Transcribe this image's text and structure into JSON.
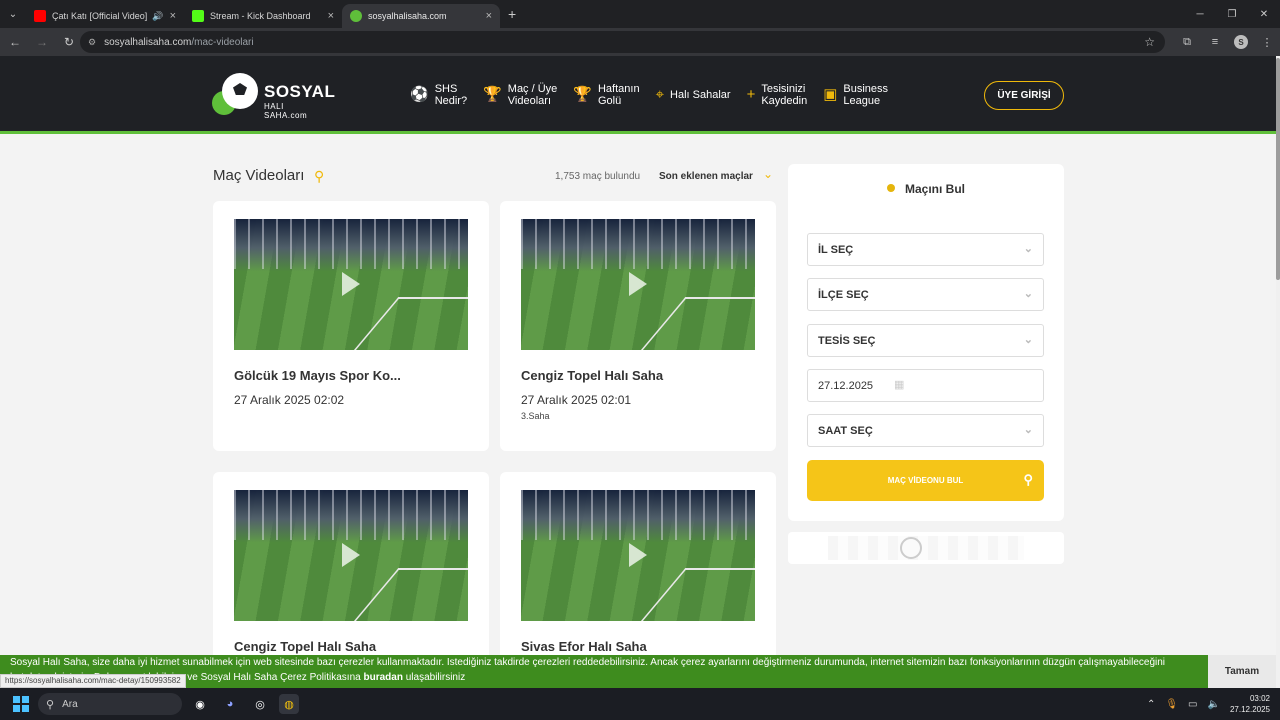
{
  "browser": {
    "tabs": [
      {
        "title": "Çatı Katı [Official Video] - G",
        "favicon_color": "#ff0000",
        "active": false,
        "audio": true
      },
      {
        "title": "Stream - Kick Dashboard",
        "favicon_color": "#53fc18",
        "active": false,
        "audio": false
      },
      {
        "title": "sosyalhalisaha.com",
        "favicon_color": "#5fbf3a",
        "active": true,
        "audio": false
      }
    ],
    "url_domain": "sosyalhalisaha.com",
    "url_path": "/mac-videolari",
    "profile_initial": "S"
  },
  "site": {
    "logo_brand": "SOSYAL",
    "logo_sub": "HALI SAHA.com",
    "nav": [
      {
        "label": "SHS\nNedir?",
        "icon": "ball-icon"
      },
      {
        "label": "Maç / Üye\nVideoları",
        "icon": "trophy-icon"
      },
      {
        "label": "Haftanın\nGolü",
        "icon": "trophy-icon"
      },
      {
        "label": "Halı Sahalar",
        "icon": "map-pin-icon"
      },
      {
        "label": "Tesisinizi\nKaydedin",
        "icon": "plus-icon"
      },
      {
        "label": "Business\nLeague",
        "icon": "badge-icon"
      }
    ],
    "login_label": "ÜYE GİRİŞİ",
    "accent": "#f0b90b",
    "brand_green": "#5fbf3a"
  },
  "listing": {
    "title": "Maç Videoları",
    "result_count": "1,753 maç bulundu",
    "sort_label": "Son eklenen maçlar",
    "cards": [
      {
        "title": "Gölcük 19 Mayıs Spor Ko...",
        "date": "27 Aralık 2025 02:02",
        "field": ""
      },
      {
        "title": "Cengiz Topel Halı Saha",
        "date": "27 Aralık 2025 02:01",
        "field": "3.Saha"
      },
      {
        "title": "Cengiz Topel Halı Saha",
        "date": "",
        "field": ""
      },
      {
        "title": "Sivas Efor Halı Saha",
        "date": "",
        "field": ""
      }
    ]
  },
  "finder": {
    "title": "Maçını Bul",
    "city_label": "İL SEÇ",
    "district_label": "İLÇE SEÇ",
    "facility_label": "TESİS SEÇ",
    "date_value": "27.12.2025",
    "time_label": "SAAT SEÇ",
    "button_label": "MAÇ VİDEONU BUL"
  },
  "cookie": {
    "line1": "Sosyal Halı Saha, size daha iyi hizmet sunabilmek için web sitesinde bazı çerezler kullanmaktadır. İstediğiniz takdirde çerezleri reddedebilirsiniz. Ancak çerez ayarlarını değiştirmeniz durumunda, internet sitemizin bazı fonksiyonlarının düzgün çalışmayabileceğini",
    "line2_prefix": "hatırlatmak isteriz. Daha ayrıntılı bilgiye ve Sosyal Halı Saha Çerez Politikasına ",
    "line2_link": "buradan",
    "line2_suffix": " ulaşabilirsiniz",
    "ok_label": "Tamam",
    "status_url": "https://sosyalhalisaha.com/mac-detay/150993582"
  },
  "taskbar": {
    "search_label": "Ara",
    "time": "03:02",
    "date": "27.12.2025"
  }
}
